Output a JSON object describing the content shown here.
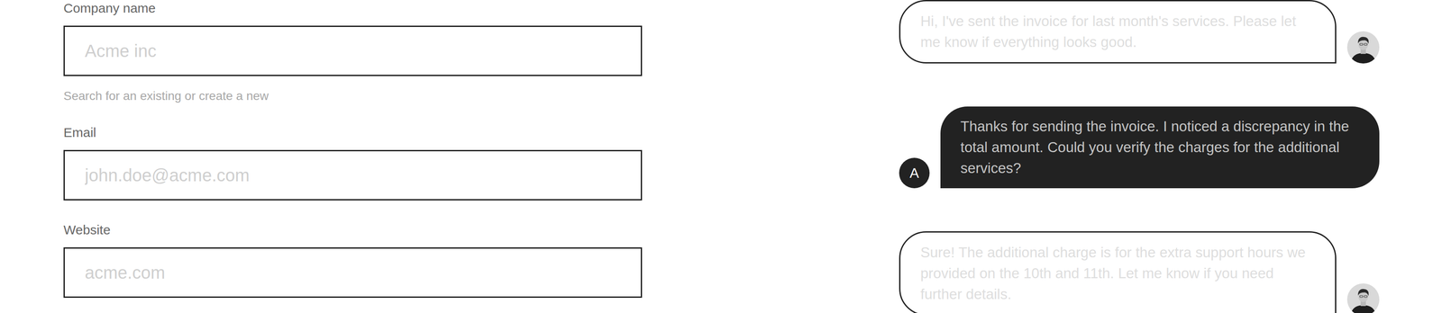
{
  "form": {
    "fields": [
      {
        "label": "Company name",
        "placeholder": "Acme inc",
        "helper": "Search for an existing or create a new"
      },
      {
        "label": "Email",
        "placeholder": "john.doe@acme.com",
        "helper": ""
      },
      {
        "label": "Website",
        "placeholder": "acme.com",
        "helper": ""
      }
    ]
  },
  "messages": [
    {
      "kind": "received",
      "avatar": "",
      "text": "Hi, I've sent the invoice for last month's services. Please let me know if everything looks good.",
      "faded": true
    },
    {
      "kind": "sent",
      "avatar": "A",
      "text": "Thanks for sending the invoice. I noticed a discrepancy in the total amount. Could you verify the charges for the additional services?",
      "faded": false
    },
    {
      "kind": "received",
      "avatar": "",
      "text": "Sure! The additional charge is for the extra support hours we provided on the 10th and 11th. Let me know if you need further details.",
      "faded": true
    }
  ]
}
